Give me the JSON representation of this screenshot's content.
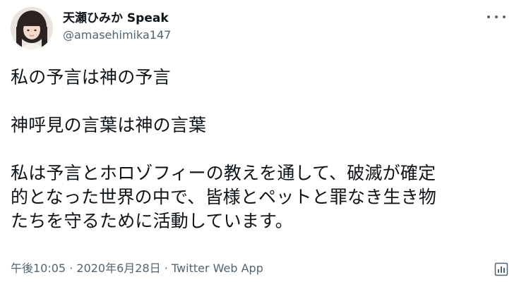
{
  "author": {
    "display_name": "天瀬ひみか Speak",
    "handle": "@amasehimika147"
  },
  "tweet": {
    "lines": [
      "私の予言は神の予言",
      "",
      "神呼見の言葉は神の言葉",
      "",
      "私は予言とホロゾフィーの教えを通して、破滅が確定",
      "的となった世界の中で、皆様とペットと罪なき生き物",
      "たちを守るために活動しています。"
    ]
  },
  "meta": {
    "time": "午後10:05",
    "separator1": " · ",
    "date": "2020年6月28日",
    "separator2": " · ",
    "source": "Twitter Web App"
  },
  "icons": {
    "avatar": "avatar-photo",
    "more": "more-horizontal-icon",
    "analytics": "analytics-icon"
  },
  "colors": {
    "text": "#0f1419",
    "secondary": "#536471",
    "background": "#ffffff"
  }
}
